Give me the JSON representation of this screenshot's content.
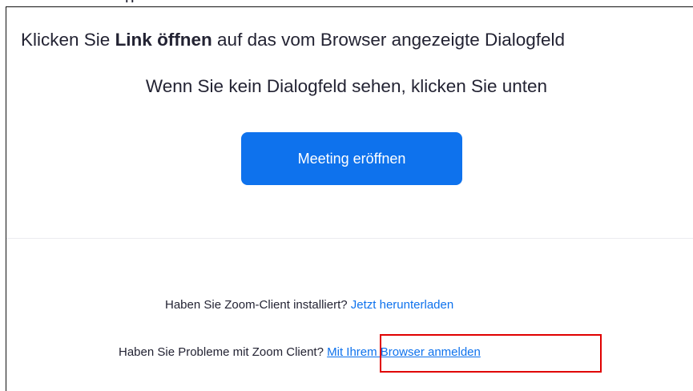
{
  "page": {
    "clipped_top_text": "p"
  },
  "prompt": {
    "headline_prefix": "Klicken Sie ",
    "headline_bold": "Link öffnen",
    "headline_suffix": " auf das vom Browser angezeigte Dialogfeld",
    "subline": "Wenn Sie kein Dialogfeld sehen, klicken Sie unten"
  },
  "actions": {
    "launch_meeting_label": "Meeting eröffnen"
  },
  "footer": {
    "download_question": "Haben Sie Zoom-Client installiert? ",
    "download_link": "Jetzt herunterladen",
    "browser_question": "Haben Sie Probleme mit Zoom Client? ",
    "browser_link": "Mit Ihrem Browser anmelden"
  },
  "colors": {
    "accent": "#0e72ed",
    "highlight": "#e00000",
    "text": "#232333"
  }
}
